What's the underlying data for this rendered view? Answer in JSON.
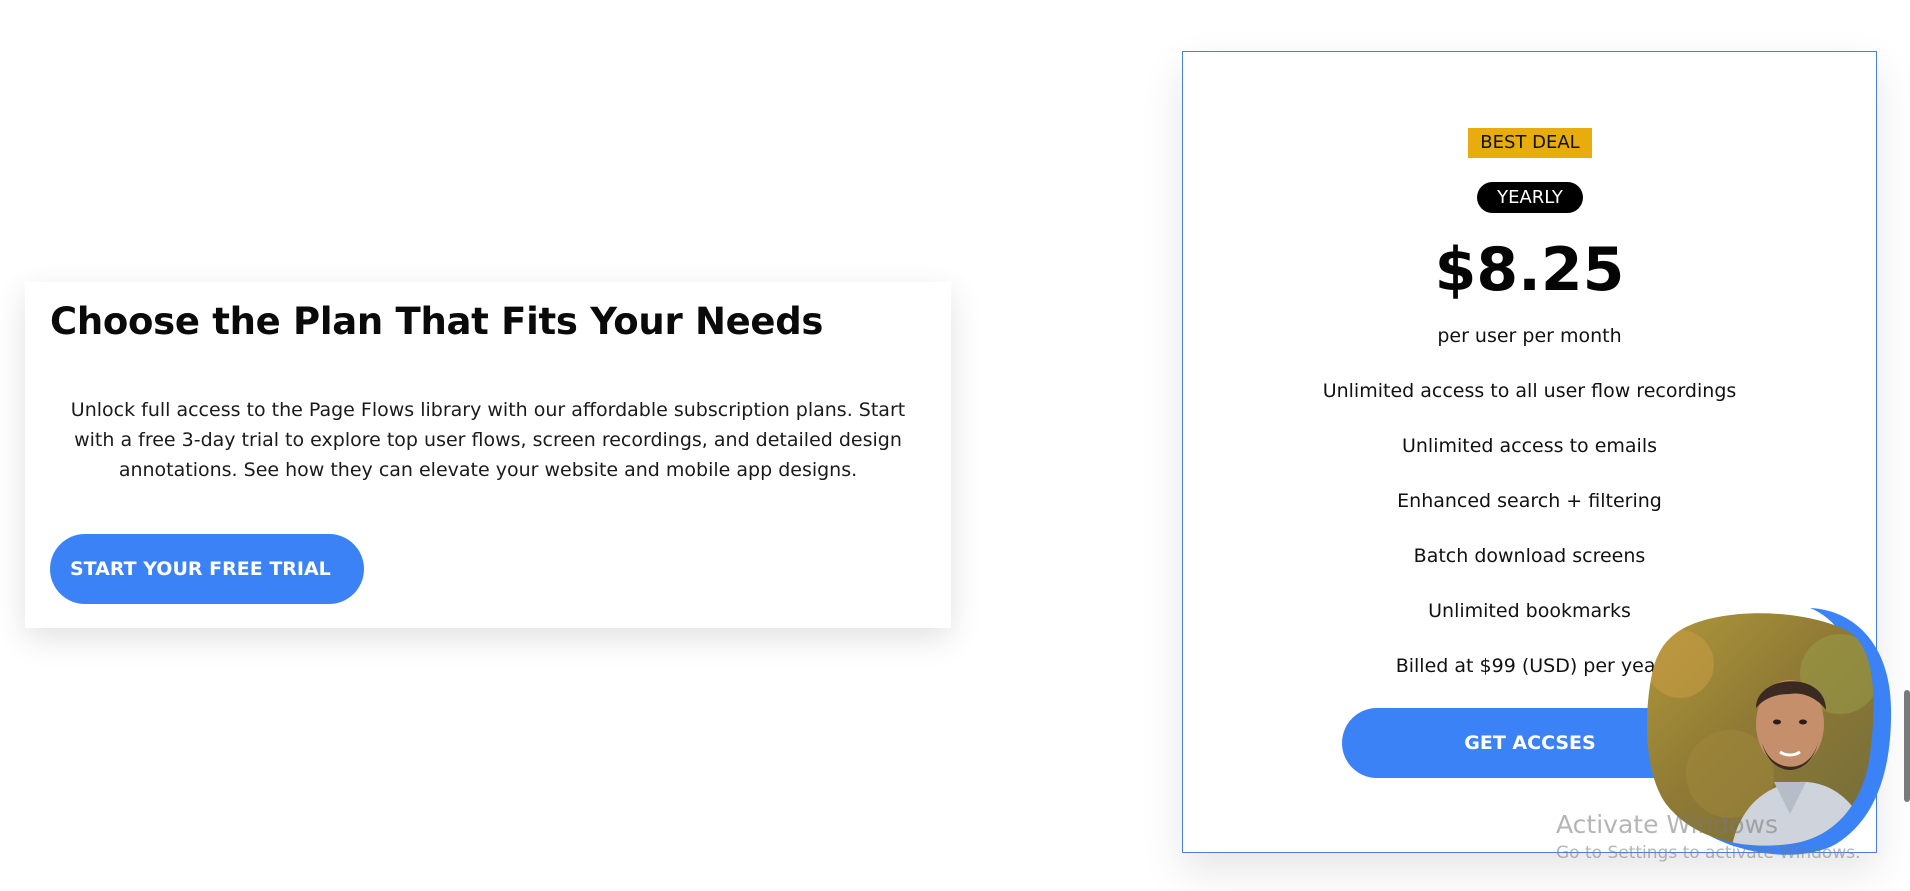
{
  "intro": {
    "title": "Choose the Plan That Fits Your Needs",
    "description": "Unlock full access to the Page Flows library with our affordable subscription plans. Start with a free 3-day trial to explore top user flows, screen recordings, and detailed design annotations. See how they can elevate your website and mobile app designs.",
    "cta_label": "START YOUR FREE TRIAL"
  },
  "pricing": {
    "badge": "BEST DEAL",
    "period": "YEARLY",
    "price": "$8.25",
    "unit": "per user per month",
    "features": [
      "Unlimited access to all user flow recordings",
      "Unlimited access to emails",
      "Enhanced search + filtering",
      "Batch download screens",
      "Unlimited bookmarks",
      "Billed at $99 (USD) per year"
    ],
    "cta_label": "GET ACCSES"
  },
  "watermark": {
    "title": "Activate Windows",
    "subtitle": "Go to Settings to activate Windows."
  },
  "colors": {
    "accent": "#3b82f6",
    "badge": "#e8ac0c",
    "border": "#4a7fe0"
  }
}
